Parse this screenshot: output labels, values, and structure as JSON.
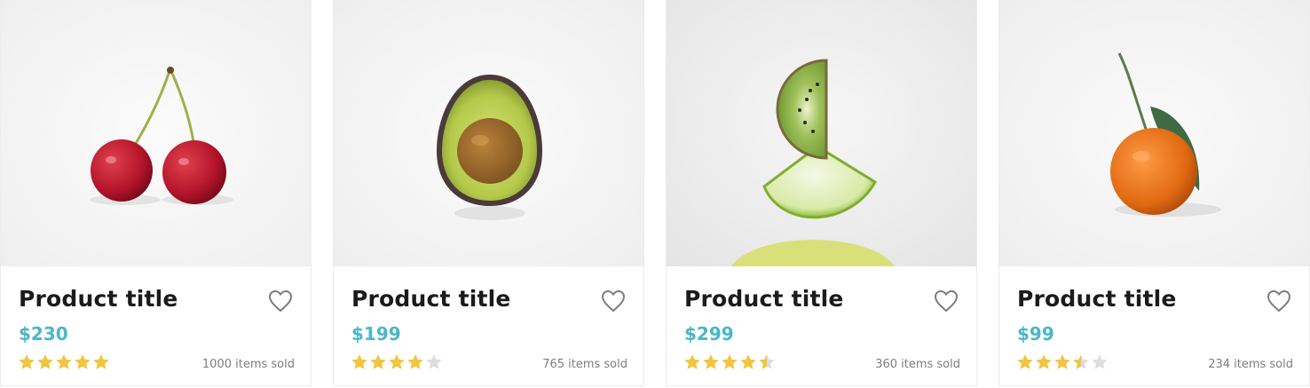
{
  "colors": {
    "price": "#4bb6c9",
    "star_filled": "#f2c53d",
    "star_empty": "#dedede",
    "title": "#1b1b1b",
    "heart_outline": "#7d7d7d"
  },
  "products": [
    {
      "title": "Product title",
      "price": "$230",
      "rating": 5,
      "sold": "1000 items sold",
      "image": "cherries-image",
      "favorite_icon": "heart-outline-icon"
    },
    {
      "title": "Product title",
      "price": "$199",
      "rating": 4,
      "sold": "765 items sold",
      "image": "avocado-image",
      "favorite_icon": "heart-outline-icon"
    },
    {
      "title": "Product title",
      "price": "$299",
      "rating": 4.5,
      "sold": "360 items sold",
      "image": "kiwi-lime-image",
      "favorite_icon": "heart-outline-icon"
    },
    {
      "title": "Product title",
      "price": "$99",
      "rating": 3.5,
      "sold": "234 items sold",
      "image": "tangerine-image",
      "favorite_icon": "heart-outline-icon"
    }
  ]
}
